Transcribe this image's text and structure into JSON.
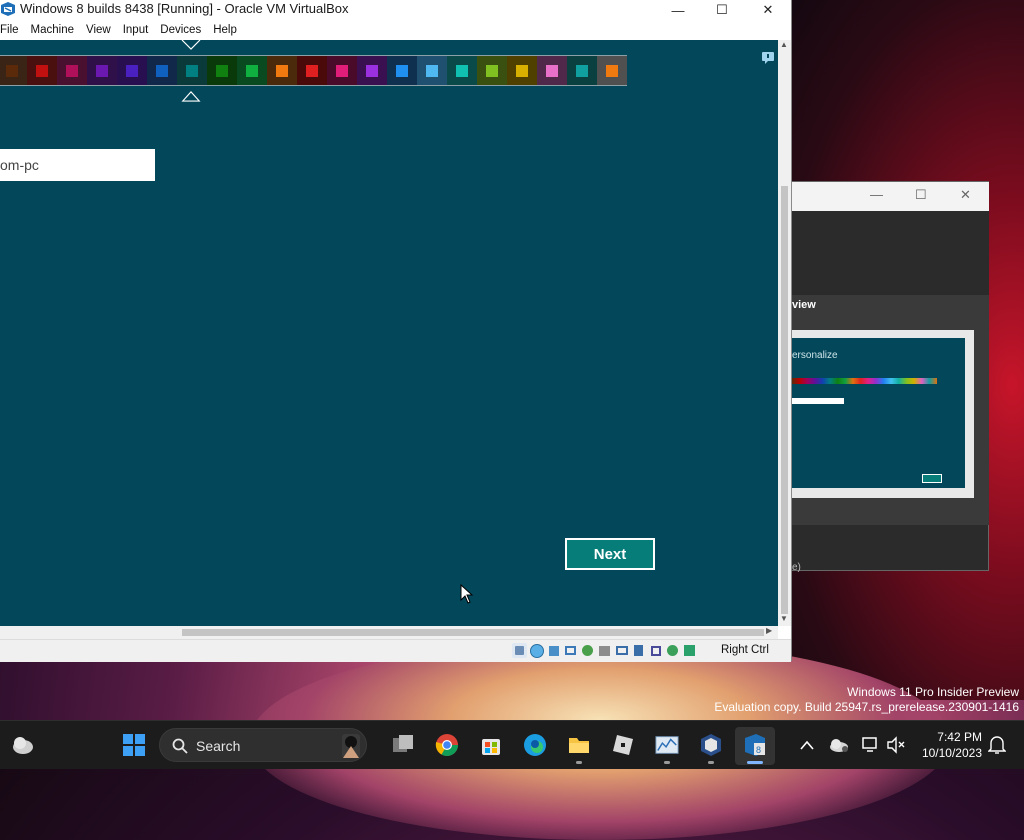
{
  "window": {
    "title": "Windows 8 builds 8438 [Running] - Oracle VM VirtualBox",
    "minimize": "—",
    "maximize": "☐",
    "close": "✕"
  },
  "menu": [
    "File",
    "Machine",
    "View",
    "Input",
    "Devices",
    "Help"
  ],
  "guest": {
    "palette": [
      "#5a2a0a",
      "#c01010",
      "#b0105a",
      "#6a18b0",
      "#4a20c0",
      "#1060c0",
      "#008080",
      "#108010",
      "#10b040",
      "#f07a10",
      "#e02020",
      "#e01e7a",
      "#9a30e0",
      "#2090f0",
      "#50b8f0",
      "#10c0b0",
      "#80c020",
      "#d8b000",
      "#e870c8",
      "#10a0a0",
      "#f07a10"
    ],
    "palette_bg": [
      "#3a2416",
      "#4a1010",
      "#4a1030",
      "#301048",
      "#281050",
      "#12284a",
      "#0a3a3a",
      "#0a3a0a",
      "#0a4a20",
      "#4a2a0a",
      "#4a0a0a",
      "#4a0a2a",
      "#3a1050",
      "#103050",
      "#205070",
      "#0a4a48",
      "#3a5010",
      "#504000",
      "#50284a",
      "#0a4040",
      "#505050"
    ],
    "selected_index": 6,
    "pc_name_value": "om-pc",
    "next_label": "Next"
  },
  "statusbar": {
    "host_key": "Right Ctrl"
  },
  "background_window": {
    "heading": "view",
    "thumb_title": "ersonalize",
    "footer": "e)"
  },
  "watermark": {
    "line1": "Windows 11 Pro Insider Preview",
    "line2": "Evaluation copy. Build 25947.rs_prerelease.230901-1416"
  },
  "taskbar": {
    "search_label": "Search",
    "time": "7:42 PM",
    "date": "10/10/2023"
  }
}
